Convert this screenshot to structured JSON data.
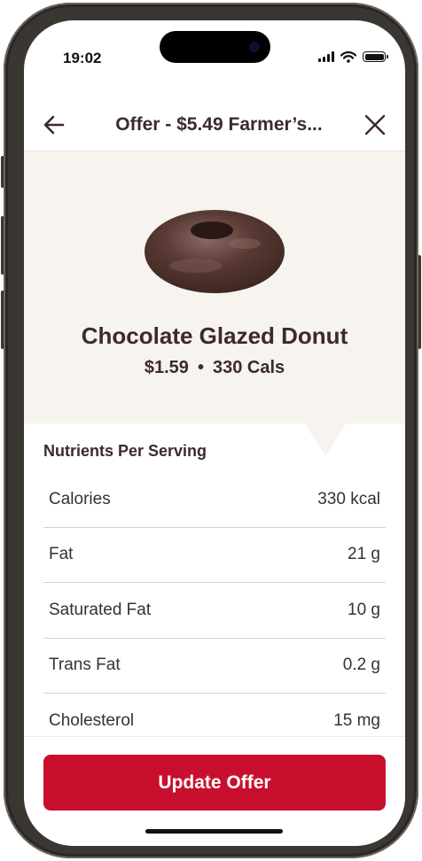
{
  "status_bar": {
    "time": "19:02"
  },
  "topbar": {
    "title": "Offer - $5.49 Farmer’s..."
  },
  "product": {
    "name": "Chocolate Glazed Donut",
    "price": "$1.59",
    "separator": "•",
    "calories": "330 Cals"
  },
  "nutrients": {
    "heading": "Nutrients Per Serving",
    "rows": [
      {
        "label": "Calories",
        "value": "330 kcal"
      },
      {
        "label": "Fat",
        "value": "21 g"
      },
      {
        "label": "Saturated Fat",
        "value": "10 g"
      },
      {
        "label": "Trans Fat",
        "value": "0.2 g"
      },
      {
        "label": "Cholesterol",
        "value": "15 mg"
      }
    ]
  },
  "footer": {
    "button_label": "Update Offer"
  },
  "colors": {
    "accent": "#c8102e",
    "text_dark": "#3d2a2a",
    "hero_bg": "#f7f3ee"
  }
}
